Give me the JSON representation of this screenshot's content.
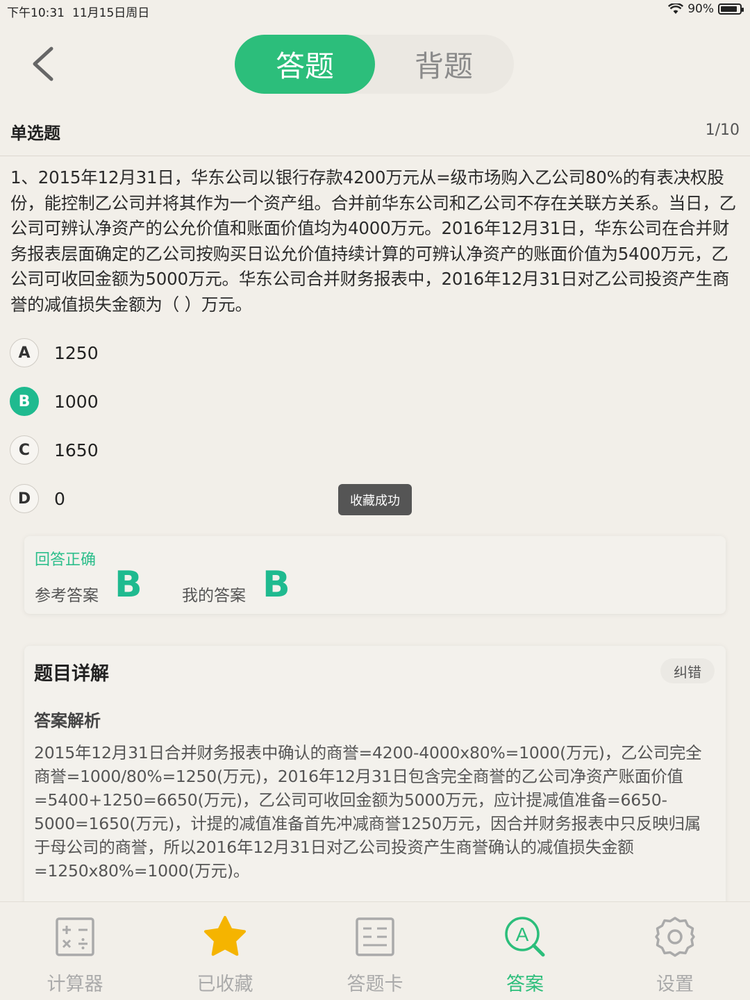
{
  "status": {
    "time": "下午10:31",
    "date": "11月15日周日",
    "battery": "90%",
    "battery_level": 0.9
  },
  "header": {
    "tabs": [
      "答题",
      "背题"
    ],
    "active_tab": 0
  },
  "question": {
    "type": "单选题",
    "counter": "1/10",
    "text": "1、2015年12月31日，华东公司以银行存款4200万元从=级市场购入乙公司80%的有表决权股份，能控制乙公司并将其作为一个资产组。合并前华东公司和乙公司不存在关联方关系。当日，乙公司可辨认净资产的公允价值和账面价值均为4000万元。2016年12月31日，华东公司在合并财务报表层面确定的乙公司按购买日讼允价值持续计算的可辨认净资产的账面价值为5400万元，乙公司可收回金额为5000万元。华东公司合并财务报表中，2016年12月31日对乙公司投资产生商誉的减值损失金额为（ ）万元。",
    "options": [
      {
        "letter": "A",
        "value": "1250"
      },
      {
        "letter": "B",
        "value": "1000"
      },
      {
        "letter": "C",
        "value": "1650"
      },
      {
        "letter": "D",
        "value": "0"
      }
    ],
    "selected": "B"
  },
  "toast": "收藏成功",
  "result": {
    "status": "回答正确",
    "ref_label": "参考答案",
    "ref_answer": "B",
    "my_label": "我的答案",
    "my_answer": "B"
  },
  "detail": {
    "title": "题目详解",
    "report_button": "纠错",
    "analysis_title": "答案解析",
    "analysis_text": "2015年12月31日合并财务报表中确认的商誉=4200-4000x80%=1000(万元)，乙公司完全商誉=1000/80%=1250(万元)，2016年12月31日包含完全商誉的乙公司净资产账面价值=5400+1250=6650(万元)，乙公司可收回金额为5000万元，应计提减值准备=6650-5000=1650(万元)，计提的减值准备首先冲减商誉1250万元，因合并财务报表中只反映归属于母公司的商誉，所以2016年12月31日对乙公司投资产生商誉确认的减值损失金额=1250x80%=1000(万元)。"
  },
  "bottom_nav": [
    {
      "label": "计算器",
      "icon": "calculator-icon"
    },
    {
      "label": "已收藏",
      "icon": "star-icon"
    },
    {
      "label": "答题卡",
      "icon": "answer-sheet-icon"
    },
    {
      "label": "答案",
      "icon": "answer-search-icon",
      "active": true
    },
    {
      "label": "设置",
      "icon": "gear-icon"
    }
  ],
  "colors": {
    "accent": "#2cbe7b",
    "answer": "#1fba8f",
    "star": "#f5b400",
    "background": "#f2efe9"
  }
}
